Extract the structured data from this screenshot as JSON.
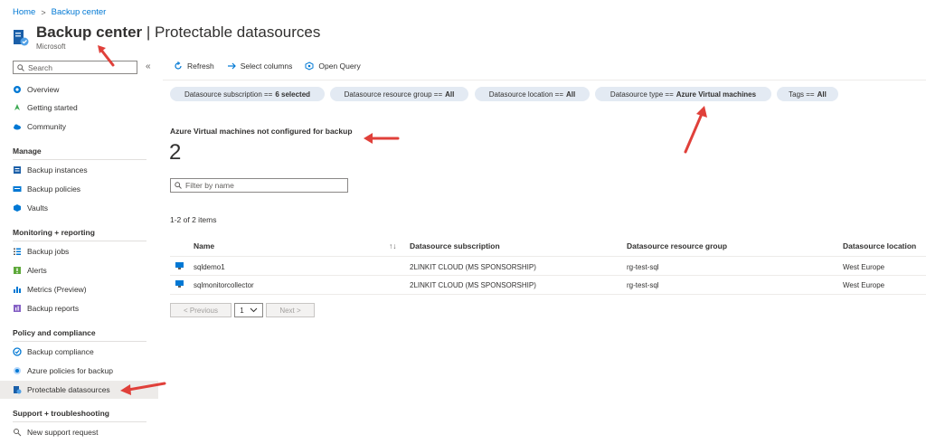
{
  "breadcrumb": {
    "home": "Home",
    "separator": ">",
    "current": "Backup center"
  },
  "header": {
    "title_bold": "Backup center",
    "title_rest": " | Protectable datasources",
    "subtitle": "Microsoft",
    "more": "···"
  },
  "sidebar": {
    "search_placeholder": "Search",
    "collapse": "«",
    "items_top": [
      {
        "label": "Overview",
        "icon": "overview-icon"
      },
      {
        "label": "Getting started",
        "icon": "rocket-icon"
      },
      {
        "label": "Community",
        "icon": "cloud-icon"
      }
    ],
    "sections": {
      "manage": "Manage",
      "monitoring": "Monitoring + reporting",
      "policy": "Policy and compliance",
      "support": "Support + troubleshooting"
    },
    "manage_items": [
      {
        "label": "Backup instances",
        "icon": "instances-icon"
      },
      {
        "label": "Backup policies",
        "icon": "policies-icon"
      },
      {
        "label": "Vaults",
        "icon": "vault-icon"
      }
    ],
    "monitoring_items": [
      {
        "label": "Backup jobs",
        "icon": "jobs-icon"
      },
      {
        "label": "Alerts",
        "icon": "alerts-icon"
      },
      {
        "label": "Metrics (Preview)",
        "icon": "metrics-icon"
      },
      {
        "label": "Backup reports",
        "icon": "reports-icon"
      }
    ],
    "policy_items": [
      {
        "label": "Backup compliance",
        "icon": "compliance-icon"
      },
      {
        "label": "Azure policies for backup",
        "icon": "azure-policy-icon"
      },
      {
        "label": "Protectable datasources",
        "icon": "datasource-icon"
      }
    ],
    "support_items": [
      {
        "label": "New support request",
        "icon": "support-icon"
      }
    ]
  },
  "toolbar": {
    "refresh": "Refresh",
    "select_columns": "Select columns",
    "open_query": "Open Query"
  },
  "filters": [
    {
      "label": "Datasource subscription ==",
      "value": "6 selected"
    },
    {
      "label": "Datasource resource group ==",
      "value": "All"
    },
    {
      "label": "Datasource location ==",
      "value": "All"
    },
    {
      "label": "Datasource type ==",
      "value": "Azure Virtual machines"
    },
    {
      "label": "Tags ==",
      "value": "All"
    }
  ],
  "kpi": {
    "label": "Azure Virtual machines not configured for backup",
    "value": "2"
  },
  "filter_input": {
    "placeholder": "Filter by name"
  },
  "count_text": "1-2 of 2 items",
  "table": {
    "headers": [
      "Name",
      "Datasource subscription",
      "Datasource resource group",
      "Datasource location"
    ],
    "sort_icon": "↑↓",
    "rows": [
      [
        "sqldemo1",
        "2LINKIT CLOUD (MS SPONSORSHIP)",
        "rg-test-sql",
        "West Europe"
      ],
      [
        "sqlmonitorcollector",
        "2LINKIT CLOUD (MS SPONSORSHIP)",
        "rg-test-sql",
        "West Europe"
      ]
    ]
  },
  "pager": {
    "previous": "< Previous",
    "page": "1",
    "next": "Next >"
  },
  "colors": {
    "accent": "#0078d4",
    "pill_bg": "#e3eaf3",
    "arrow": "#e0403a"
  }
}
